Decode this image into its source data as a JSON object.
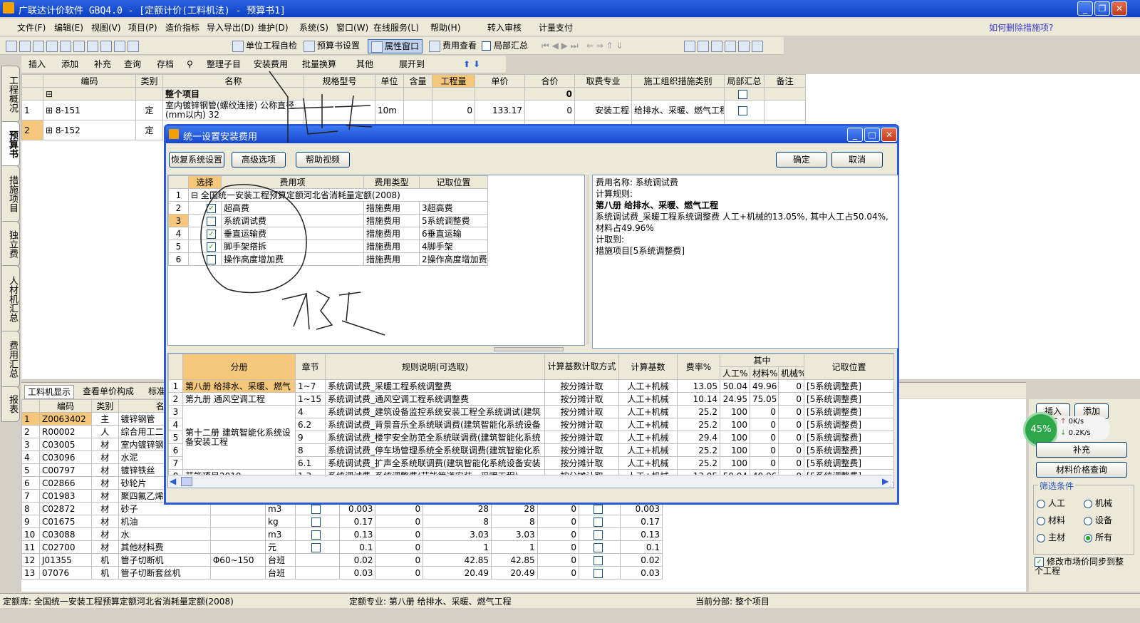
{
  "title": "广联达计价软件 GBQ4.0 - [定额计价(工料机法) - 预算书1]",
  "help_link": "如何删除措施项?",
  "menu": [
    "文件(F)",
    "编辑(E)",
    "视图(V)",
    "项目(P)",
    "造价指标",
    "导入导出(D)",
    "维护(D)",
    "系统(S)",
    "窗口(W)",
    "在线服务(L)",
    "帮助(H)",
    "转入审核",
    "计量支付"
  ],
  "toolbar1": {
    "b1": "单位工程自检",
    "b2": "预算书设置",
    "b3": "属性窗口",
    "b4": "费用查看",
    "b5": "局部汇总"
  },
  "toolbar2": [
    "插入",
    "添加",
    "补充",
    "查询",
    "存档",
    "整理子目",
    "安装费用",
    "批量换算",
    "其他",
    "展开到"
  ],
  "side_tabs": [
    "工程概况",
    "预算书",
    "措施项目",
    "独立费",
    "人材机汇总",
    "费用汇总",
    "报表"
  ],
  "main_grid": {
    "headers": [
      "编码",
      "类别",
      "名称",
      "规格型号",
      "单位",
      "含量",
      "工程量",
      "单价",
      "合价",
      "取费专业",
      "施工组织措施类别",
      "局部汇总",
      "备注"
    ],
    "top_row": {
      "name": "整个项目",
      "total": "0"
    },
    "rows": [
      {
        "no": "1",
        "code": "8-151",
        "type": "定",
        "name": "室内镀锌钢管(螺纹连接) 公称直径(mm以内) 32",
        "unit": "10m",
        "qty": "0",
        "price": "133.17",
        "sum": "0",
        "spec": "安装工程",
        "cat": "给排水、采暖、燃气工程"
      },
      {
        "no": "2",
        "code": "8-152",
        "type": "定",
        "name": "室内镀",
        "unit": "",
        "qty": "",
        "price": "",
        "sum": "",
        "spec": "",
        "cat": ""
      }
    ]
  },
  "bottom_tabs": [
    "工料机显示",
    "查看单价构成",
    "标准"
  ],
  "bottom_grid": {
    "headers": [
      "编码",
      "类别",
      "名称"
    ],
    "rows": [
      {
        "no": "1",
        "code": "Z0063402",
        "type": "主",
        "name": "镀锌钢管",
        "spec": "",
        "unit": "",
        "c1": "",
        "c2": "",
        "c3": "",
        "c4": "",
        "c5": "",
        "c6": ""
      },
      {
        "no": "2",
        "code": "R00002",
        "type": "人",
        "name": "综合用工二类",
        "spec": "",
        "unit": "",
        "c1": "",
        "c2": "",
        "c3": "",
        "c4": "",
        "c5": "",
        "c6": ""
      },
      {
        "no": "3",
        "code": "C03005",
        "type": "材",
        "name": "室内镀锌钢管",
        "spec": "",
        "unit": "",
        "c1": "",
        "c2": "",
        "c3": "",
        "c4": "",
        "c5": "",
        "c6": ""
      },
      {
        "no": "4",
        "code": "C03096",
        "type": "材",
        "name": "水泥",
        "spec": "",
        "unit": "",
        "c1": "",
        "c2": "",
        "c3": "",
        "c4": "",
        "c5": "",
        "c6": ""
      },
      {
        "no": "5",
        "code": "C00797",
        "type": "材",
        "name": "镀锌铁丝",
        "spec": "",
        "unit": "",
        "c1": "",
        "c2": "",
        "c3": "",
        "c4": "",
        "c5": "",
        "c6": ""
      },
      {
        "no": "6",
        "code": "C02866",
        "type": "材",
        "name": "砂轮片",
        "spec": "",
        "unit": "",
        "c1": "",
        "c2": "",
        "c3": "",
        "c4": "",
        "c5": "",
        "c6": ""
      },
      {
        "no": "7",
        "code": "C01983",
        "type": "材",
        "name": "聚四氟乙烯生料带",
        "spec": "",
        "unit": "",
        "c1": "",
        "c2": "",
        "c3": "",
        "c4": "",
        "c5": "",
        "c6": ""
      },
      {
        "no": "8",
        "code": "C02872",
        "type": "材",
        "name": "砂子",
        "spec": "",
        "unit": "m3",
        "c1": "0.003",
        "c2": "0",
        "c3": "28",
        "c4": "28",
        "c5": "0",
        "c6": "0.003"
      },
      {
        "no": "9",
        "code": "C01675",
        "type": "材",
        "name": "机油",
        "spec": "",
        "unit": "kg",
        "c1": "0.17",
        "c2": "0",
        "c3": "8",
        "c4": "8",
        "c5": "0",
        "c6": "0.17"
      },
      {
        "no": "10",
        "code": "C03088",
        "type": "材",
        "name": "水",
        "spec": "",
        "unit": "m3",
        "c1": "0.13",
        "c2": "0",
        "c3": "3.03",
        "c4": "3.03",
        "c5": "0",
        "c6": "0.13"
      },
      {
        "no": "11",
        "code": "C02700",
        "type": "材",
        "name": "其他材料费",
        "spec": "",
        "unit": "元",
        "c1": "0.1",
        "c2": "0",
        "c3": "1",
        "c4": "1",
        "c5": "0",
        "c6": "0.1"
      },
      {
        "no": "12",
        "code": "J01355",
        "type": "机",
        "name": "管子切断机",
        "spec": "Φ60~150",
        "unit": "台班",
        "c1": "0.02",
        "c2": "0",
        "c3": "42.85",
        "c4": "42.85",
        "c5": "0",
        "c6": "0.02"
      },
      {
        "no": "13",
        "code": "07076",
        "type": "机",
        "name": "管子切断套丝机",
        "spec": "",
        "unit": "台班",
        "c1": "0.03",
        "c2": "0",
        "c3": "20.49",
        "c4": "20.49",
        "c5": "0",
        "c6": "0.03"
      }
    ]
  },
  "right_panel": {
    "insert": "插入",
    "add": "添加",
    "supplement": "补充",
    "price_query": "材料价格查询",
    "filter_title": "筛选条件",
    "filters": [
      "人工",
      "机械",
      "材料",
      "设备",
      "主材",
      "所有"
    ],
    "sync": "修改市场价同步到整个工程",
    "gauge": "45%",
    "speed_up": "0K/s",
    "speed_down": "0.2K/s"
  },
  "status": {
    "lib": "定额库: 全国统一安装工程预算定额河北省消耗量定额(2008)",
    "major": "定额专业: 第八册 给排水、采暖、燃气工程",
    "part": "当前分部: 整个项目"
  },
  "dialog": {
    "title": "统一设置安装费用",
    "btn_restore": "恢复系统设置",
    "btn_adv": "高级选项",
    "btn_help": "帮助视频",
    "btn_ok": "确定",
    "btn_cancel": "取消",
    "list_headers": [
      "选择",
      "费用项",
      "费用类型",
      "记取位置"
    ],
    "list_root": "全国统一安装工程预算定额河北省消耗量定额(2008)",
    "items": [
      {
        "no": "2",
        "name": "超高费",
        "type": "措施费用",
        "pos": "3超高费",
        "checked": true
      },
      {
        "no": "3",
        "name": "系统调试费",
        "type": "措施费用",
        "pos": "5系统调整费",
        "checked": false
      },
      {
        "no": "4",
        "name": "垂直运输费",
        "type": "措施费用",
        "pos": "6垂直运输",
        "checked": true
      },
      {
        "no": "5",
        "name": "脚手架搭拆",
        "type": "措施费用",
        "pos": "4脚手架",
        "checked": true
      },
      {
        "no": "6",
        "name": "操作高度增加费",
        "type": "措施费用",
        "pos": "2操作高度增加费",
        "checked": false
      }
    ],
    "info": {
      "l1": "费用名称: 系统调试费",
      "l2": "计算规则:",
      "l3": "第八册 给排水、采暖、燃气工程",
      "l4": "系统调试费_采暖工程系统调整费 人工+机械的13.05%, 其中人工占50.04%,材料占49.96%",
      "l5": "计取到:",
      "l6": "措施项目[5系统调整费]"
    },
    "rule_headers": {
      "book": "分册",
      "chapter": "章节",
      "rule": "规则说明(可选取)",
      "method": "计算基数计取方式",
      "base": "计算基数",
      "rate": "费率%",
      "among": "其中",
      "labor": "人工%",
      "mat": "材料%",
      "mach": "机械%",
      "pos": "记取位置"
    },
    "rules": [
      {
        "no": "1",
        "book": "第八册 给排水、采暖、燃气",
        "chapter": "1~7",
        "rule": "系统调试费_采暖工程系统调整费",
        "method": "按分摊计取",
        "base": "人工+机械",
        "rate": "13.05",
        "labor": "50.04",
        "mat": "49.96",
        "mach": "0",
        "pos": "[5系统调整费]"
      },
      {
        "no": "2",
        "book": "第九册 通风空调工程",
        "chapter": "1~15",
        "rule": "系统调试费_通风空调工程系统调整费",
        "method": "按分摊计取",
        "base": "人工+机械",
        "rate": "10.14",
        "labor": "24.95",
        "mat": "75.05",
        "mach": "0",
        "pos": "[5系统调整费]"
      },
      {
        "no": "3",
        "book": "",
        "chapter": "4",
        "rule": "系统调试费_建筑设备监控系统安装工程全系统调试(建筑",
        "method": "按分摊计取",
        "base": "人工+机械",
        "rate": "25.2",
        "labor": "100",
        "mat": "0",
        "mach": "0",
        "pos": "[5系统调整费]"
      },
      {
        "no": "4",
        "book": "",
        "chapter": "6.2",
        "rule": "系统调试费_背景音乐全系统联调费(建筑智能化系统设备",
        "method": "按分摊计取",
        "base": "人工+机械",
        "rate": "25.2",
        "labor": "100",
        "mat": "0",
        "mach": "0",
        "pos": "[5系统调整费]"
      },
      {
        "no": "5",
        "book": "第十二册 建筑智能化系统设备安装工程",
        "chapter": "9",
        "rule": "系统调试费_楼宇安全防范全系统联调费(建筑智能化系统",
        "method": "按分摊计取",
        "base": "人工+机械",
        "rate": "29.4",
        "labor": "100",
        "mat": "0",
        "mach": "0",
        "pos": "[5系统调整费]"
      },
      {
        "no": "6",
        "book": "",
        "chapter": "8",
        "rule": "系统调试费_停车场管理系统全系统联调费(建筑智能化系",
        "method": "按分摊计取",
        "base": "人工+机械",
        "rate": "25.2",
        "labor": "100",
        "mat": "0",
        "mach": "0",
        "pos": "[5系统调整费]"
      },
      {
        "no": "7",
        "book": "",
        "chapter": "6.1",
        "rule": "系统调试费_扩声全系统联调费(建筑智能化系统设备安装",
        "method": "按分摊计取",
        "base": "人工+机械",
        "rate": "25.2",
        "labor": "100",
        "mat": "0",
        "mach": "0",
        "pos": "[5系统调整费]"
      },
      {
        "no": "8",
        "book": "节能项目2010",
        "chapter": "1,3",
        "rule": "系统调试费_系统调整费(节能管道安装、采暖工程)",
        "method": "按分摊计取",
        "base": "人工+机械",
        "rate": "13.05",
        "labor": "50.04",
        "mat": "49.96",
        "mach": "0",
        "pos": "[5系统调整费]"
      }
    ]
  },
  "colors": {
    "titlebar": "#0a3fc4",
    "highlight": "#f5c77a",
    "chrome": "#ece9d8"
  }
}
